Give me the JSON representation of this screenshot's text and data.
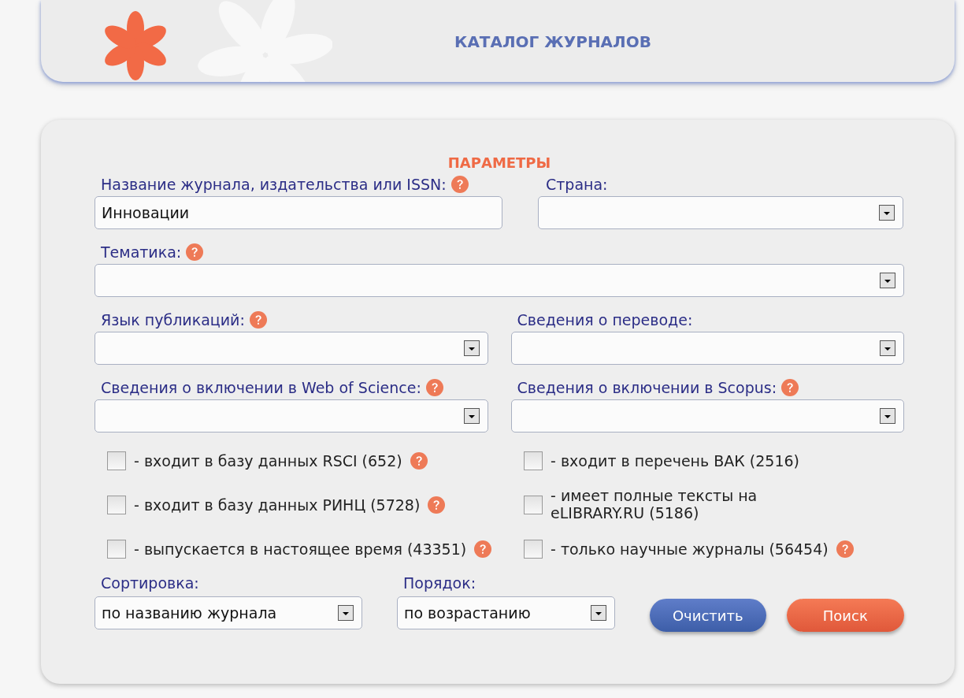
{
  "header": {
    "title": "КАТАЛОГ ЖУРНАЛОВ"
  },
  "form": {
    "title": "ПАРАМЕТРЫ",
    "rows": [
      [
        {
          "label": "Название журнала, издательства или ISSN:",
          "help": true,
          "kind": "text",
          "value": "Инновации"
        },
        {
          "label": "Страна:",
          "help": false,
          "kind": "select"
        }
      ],
      [
        {
          "label": "Тематика:",
          "help": true,
          "kind": "select"
        }
      ],
      [
        {
          "label": "Язык публикаций:",
          "help": true,
          "kind": "select"
        },
        {
          "label": "Сведения о переводе:",
          "help": false,
          "kind": "select"
        }
      ],
      [
        {
          "label": "Сведения о включении в Web of Science:",
          "help": true,
          "kind": "select"
        },
        {
          "label": "Сведения о включении в Scopus:",
          "help": true,
          "kind": "select"
        }
      ]
    ],
    "checkboxes": [
      {
        "label": "- входит в базу данных RSCI (652)",
        "checked": false,
        "help": true
      },
      {
        "label": "- входит в перечень ВАК (2516)",
        "checked": false,
        "help": false
      },
      {
        "label": "- входит в базу данных РИНЦ (5728)",
        "checked": false,
        "help": true
      },
      {
        "label": "- имеет полные тексты на eLIBRARY.RU (5186)",
        "checked": false,
        "help": false
      },
      {
        "label": "- выпускается в настоящее время (43351)",
        "checked": false,
        "help": true
      },
      {
        "label": "- только научные журналы (56454)",
        "checked": false,
        "help": true
      }
    ],
    "sort": {
      "label": "Сортировка:",
      "value": "по названию журнала"
    },
    "order": {
      "label": "Порядок:",
      "value": "по возрастанию"
    },
    "buttons": [
      {
        "label": "Очистить",
        "kind": "clear"
      },
      {
        "label": "Поиск",
        "kind": "search"
      }
    ]
  }
}
